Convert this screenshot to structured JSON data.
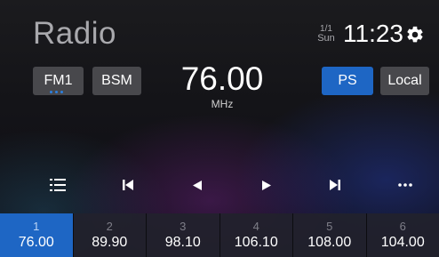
{
  "header": {
    "title": "Radio",
    "date_line1": "1/1",
    "date_line2": "Sun",
    "time": "11:23",
    "settings_icon": "gear-icon"
  },
  "tuner": {
    "band_label": "FM1",
    "bsm_label": "BSM",
    "frequency": "76.00",
    "unit": "MHz",
    "ps_label": "PS",
    "local_label": "Local"
  },
  "controls": {
    "icons": [
      "list-icon",
      "skip-previous-icon",
      "seek-back-icon",
      "seek-forward-icon",
      "skip-next-icon",
      "more-icon"
    ]
  },
  "presets": [
    {
      "number": "1",
      "frequency": "76.00",
      "active": true
    },
    {
      "number": "2",
      "frequency": "89.90",
      "active": false
    },
    {
      "number": "3",
      "frequency": "98.10",
      "active": false
    },
    {
      "number": "4",
      "frequency": "106.10",
      "active": false
    },
    {
      "number": "5",
      "frequency": "108.00",
      "active": false
    },
    {
      "number": "6",
      "frequency": "104.00",
      "active": false
    }
  ],
  "colors": {
    "accent": "#1e66c4",
    "button_gray": "#48484c",
    "title_gray": "#a9a9ad"
  }
}
